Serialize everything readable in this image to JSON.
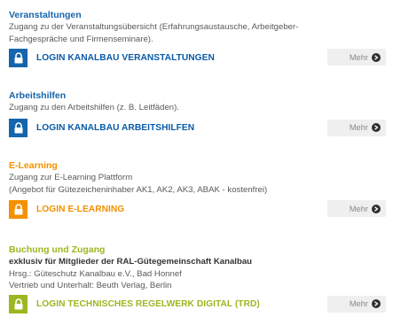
{
  "colors": {
    "blue": "#1565ad",
    "orange": "#f39100",
    "green": "#9bb721",
    "dark_blue_text": "#0a5ba8"
  },
  "sections": [
    {
      "title": "Veranstaltungen",
      "lines": [
        "Zugang zu der Veranstaltungsübersicht (Erfahrungsaustausche, Arbeitgeber-",
        "Fachgespräche und Firmenseminare)."
      ],
      "login_label": "LOGIN KANALBAU VERANSTALTUNGEN",
      "more_label": "Mehr"
    },
    {
      "title": "Arbeitshilfen",
      "lines": [
        "Zugang zu den Arbeitshilfen (z. B. Leitfäden)."
      ],
      "login_label": "LOGIN KANALBAU ARBEITSHILFEN",
      "more_label": "Mehr"
    },
    {
      "title": "E-Learning",
      "lines": [
        "Zugang zur E-Learning Plattform",
        "(Angebot für Gütezeicheninhaber AK1, AK2, AK3, ABAK - kostenfrei)"
      ],
      "login_label": "LOGIN E-LEARNING",
      "more_label": "Mehr"
    },
    {
      "title": "Buchung und Zugang",
      "lines_bold": "exklusiv für Mitglieder der RAL-Gütegemeinschaft Kanalbau",
      "lines": [
        "Hrsg.: Güteschutz Kanalbau e.V., Bad Honnef",
        "Vertrieb und Unterhalt: Beuth Verlag, Berlin"
      ],
      "login_label": "LOGIN TECHNISCHES REGELWERK DIGITAL (TRD)",
      "more_label": "Mehr"
    }
  ]
}
